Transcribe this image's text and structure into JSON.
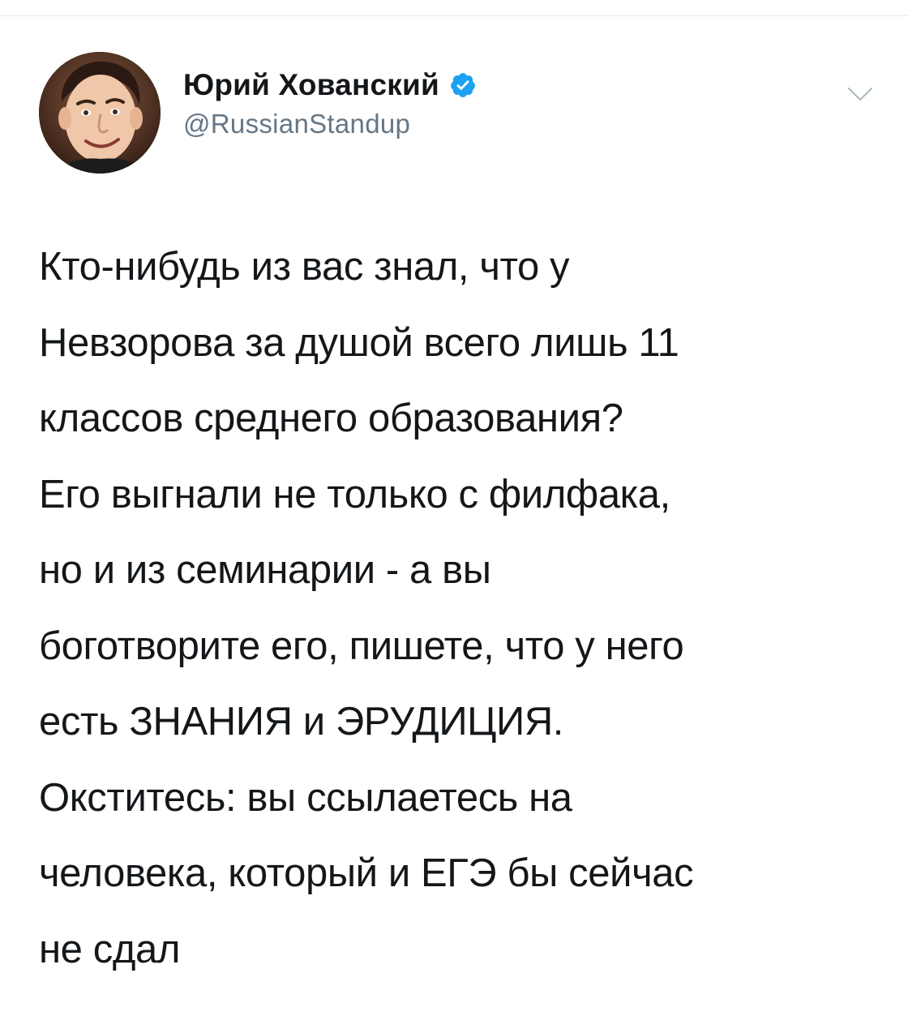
{
  "user": {
    "display_name": "Юрий Хованский",
    "handle": "@RussianStandup",
    "verified": true
  },
  "tweet": {
    "lines": [
      "Кто-нибудь из вас знал, что у",
      "Невзорова за душой всего лишь 11",
      "классов среднего образования?",
      "Его выгнали не только с филфака,",
      "но и из семинарии - а вы",
      "боготворите его, пишете, что у него",
      "есть ЗНАНИЯ и ЭРУДИЦИЯ.",
      "Окститесь: вы ссылаетесь на",
      "человека, который и ЕГЭ бы сейчас",
      "не сдал"
    ]
  },
  "icons": {
    "avatar": "avatar",
    "verified": "verified-badge-icon",
    "menu": "chevron-down-icon"
  },
  "colors": {
    "text": "#14171a",
    "secondary": "#657786",
    "verified": "#1da1f2",
    "divider": "#e6ecf0"
  }
}
